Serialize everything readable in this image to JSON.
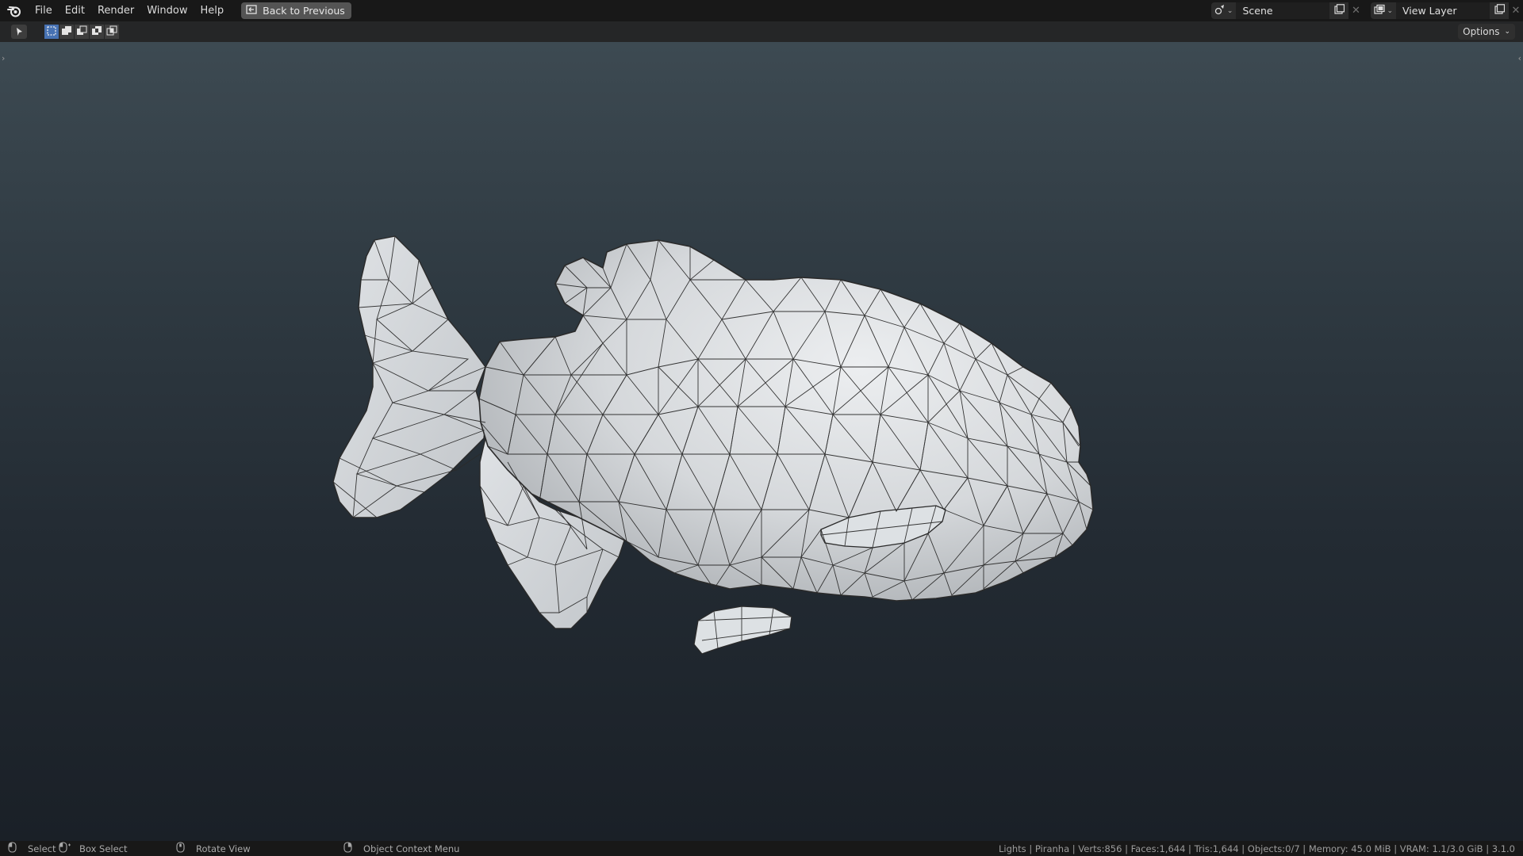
{
  "menubar": {
    "items": [
      "File",
      "Edit",
      "Render",
      "Window",
      "Help"
    ],
    "back_button": "Back to Previous"
  },
  "scene_selector": {
    "value": "Scene"
  },
  "view_layer_selector": {
    "value": "View Layer"
  },
  "header": {
    "options_label": "Options"
  },
  "viewport": {
    "object_name": "Piranha",
    "shading": "solid-wireframe",
    "background_top": "#3d4a52",
    "background_bottom": "#1a2027",
    "mesh_color": "#d9dcdf"
  },
  "statusbar": {
    "hints": [
      {
        "icon": "mouse-left-icon",
        "label": "Select"
      },
      {
        "icon": "mouse-drag-icon",
        "label": "Box Select"
      },
      {
        "icon": "mouse-middle-icon",
        "label": "Rotate View"
      },
      {
        "icon": "mouse-right-icon",
        "label": "Object Context Menu"
      }
    ],
    "stats": "Lights | Piranha | Verts:856 | Faces:1,644 | Tris:1,644 | Objects:0/7 | Memory: 45.0 MiB | VRAM: 1.1/3.0 GiB | 3.1.0"
  }
}
